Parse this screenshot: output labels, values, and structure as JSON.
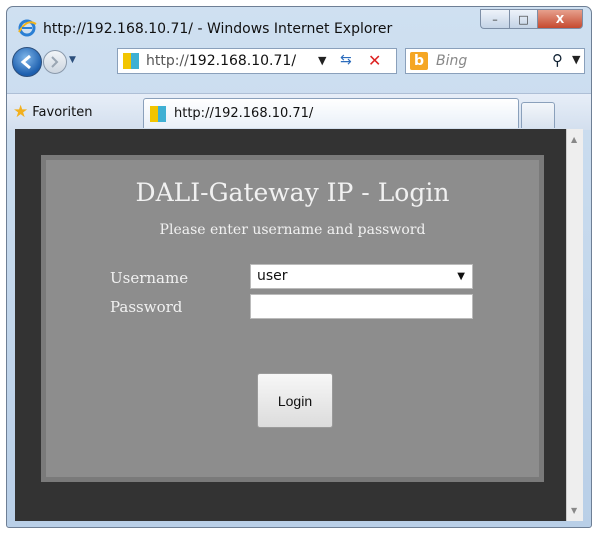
{
  "window": {
    "title": "http://192.168.10.71/ - Windows Internet Explorer",
    "controls": {
      "minimize": "–",
      "maximize": "□",
      "close": "X"
    }
  },
  "navbar": {
    "address_prefix": "http://",
    "address_host": "192.168.10.71/",
    "search_placeholder": "Bing"
  },
  "favorites_bar": {
    "favorites_label": "Favoriten",
    "tab_label": "http://192.168.10.71/"
  },
  "login": {
    "title": "DALI-Gateway IP - Login",
    "subtitle": "Please enter username and password",
    "username_label": "Username",
    "username_value": "user",
    "password_label": "Password",
    "password_value": "",
    "login_button": "Login"
  },
  "colors": {
    "page_bg": "#333333",
    "panel_bg": "#8d8d8d",
    "panel_border": "#7a7a7a",
    "text_light": "#f1f1f1"
  },
  "icons": [
    "ie-logo-icon",
    "back-arrow-icon",
    "forward-arrow-icon",
    "page-icon",
    "refresh-icon",
    "stop-icon",
    "bing-icon",
    "search-icon",
    "star-icon"
  ]
}
